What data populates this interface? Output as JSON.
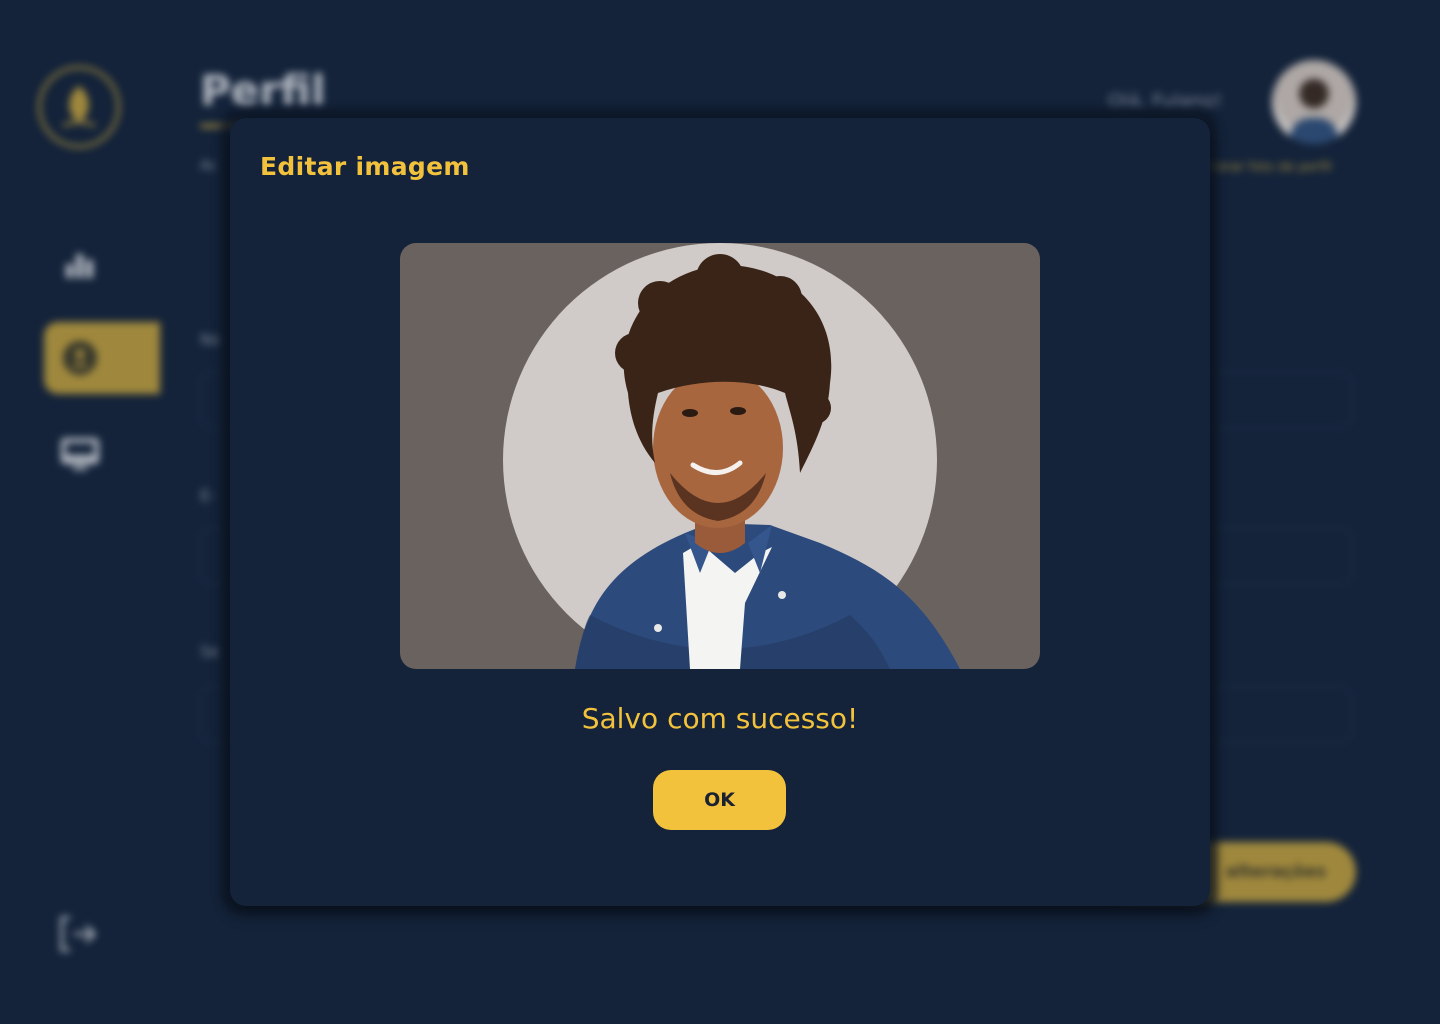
{
  "background": {
    "page_title": "Perfil",
    "page_subtitle": "Ac",
    "greeting": "Olá, Fulano!",
    "avatar_link": "Alterar foto de perfil",
    "nav": [
      {
        "icon": "chart-icon"
      },
      {
        "icon": "user-icon",
        "active": true
      },
      {
        "icon": "monitor-icon"
      }
    ],
    "fields": [
      {
        "label": "No"
      },
      {
        "label": "E-"
      },
      {
        "label": "Se"
      }
    ],
    "save_label": "alterações",
    "logout_icon": "logout-icon"
  },
  "modal": {
    "title": "Editar imagem",
    "success_message": "Salvo com sucesso!",
    "ok_label": "OK"
  },
  "colors": {
    "background": "#14233a",
    "accent": "#f3c23d",
    "muted_accent": "#b89a3e"
  }
}
